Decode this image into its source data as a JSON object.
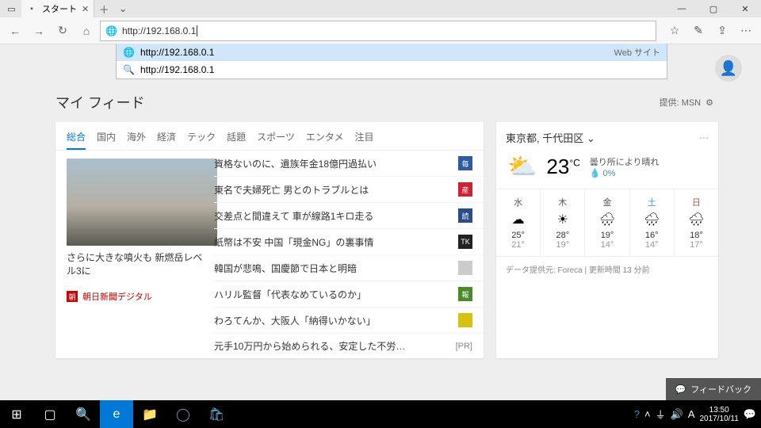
{
  "window": {
    "tab_title": "スタート",
    "min": "—",
    "max": "▢",
    "close": "✕"
  },
  "address": {
    "url": "http://192.168.0.1",
    "suggest": [
      {
        "icon": "globe",
        "text": "http://192.168.0.1",
        "right": "Web サイト"
      },
      {
        "icon": "search",
        "text": "http://192.168.0.1",
        "right": ""
      }
    ]
  },
  "page": {
    "feed_title": "マイ フィード",
    "provided_by": "提供: MSN",
    "news": {
      "tabs": [
        "総合",
        "国内",
        "海外",
        "経済",
        "テック",
        "話題",
        "スポーツ",
        "エンタメ",
        "注目"
      ],
      "feature": {
        "title": "さらに大きな噴火も 新燃岳レベル3に",
        "source": "朝日新聞デジタル",
        "source_badge": "朝"
      },
      "headlines": [
        {
          "t": "資格ないのに、遺族年金18億円過払い",
          "b": "毎",
          "bg": "#2d5aa0"
        },
        {
          "t": "東名で夫婦死亡 男とのトラブルとは",
          "b": "産",
          "bg": "#c23"
        },
        {
          "t": "交差点と間違えて 車が線路1キロ走る",
          "b": "読",
          "bg": "#2a4d8a"
        },
        {
          "t": "紙幣は不安 中国「現金NG」の裏事情",
          "b": "TK",
          "bg": "#222"
        },
        {
          "t": "韓国が悲鳴、国慶節で日本と明暗",
          "b": "",
          "bg": "#ccc"
        },
        {
          "t": "ハリル監督「代表なめているのか」",
          "b": "報",
          "bg": "#4a8a2a"
        },
        {
          "t": "わろてんか、大阪人「納得いかない」",
          "b": "",
          "bg": "#d9c112"
        },
        {
          "t": "元手10万円から始められる、安定した不労…",
          "b": "[PR]",
          "pr": true
        }
      ]
    },
    "weather": {
      "location": "東京都, 千代田区",
      "temp": "23",
      "unit": "°C",
      "cond": "曇り所により晴れ",
      "precip": "0%",
      "days": [
        {
          "d": "水",
          "cls": "",
          "icon": "☁",
          "hi": "25°",
          "lo": "21°"
        },
        {
          "d": "木",
          "cls": "",
          "icon": "☀",
          "hi": "28°",
          "lo": "19°"
        },
        {
          "d": "金",
          "cls": "",
          "icon": "🌧",
          "hi": "19°",
          "lo": "14°"
        },
        {
          "d": "土",
          "cls": "sat",
          "icon": "🌧",
          "hi": "16°",
          "lo": "14°"
        },
        {
          "d": "日",
          "cls": "sun",
          "icon": "🌧",
          "hi": "18°",
          "lo": "17°"
        }
      ],
      "footer": "データ提供元: Foreca | 更新時間 13 分前"
    },
    "feedback": "フィードバック"
  },
  "taskbar": {
    "time": "13:50",
    "date": "2017/10/11"
  }
}
